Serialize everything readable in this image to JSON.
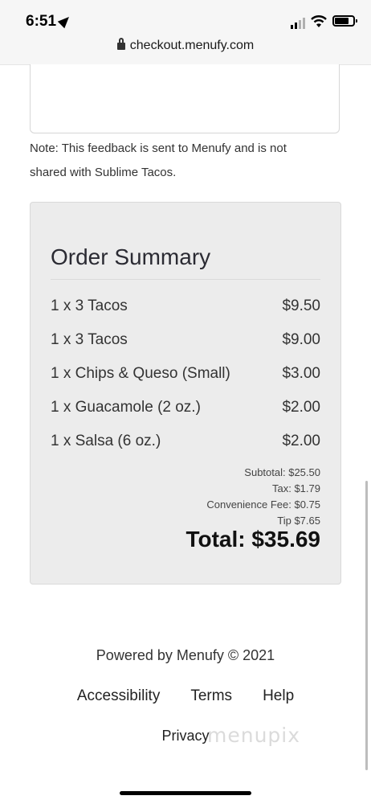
{
  "status_bar": {
    "time": "6:51",
    "url": "checkout.menufy.com"
  },
  "feedback": {
    "note_line1": "Note: This feedback is sent to Menufy and is not",
    "note_line2": "shared with Sublime Tacos."
  },
  "order_summary": {
    "title": "Order Summary",
    "items": [
      {
        "label": "1 x 3 Tacos",
        "price": "$9.50"
      },
      {
        "label": "1 x 3 Tacos",
        "price": "$9.00"
      },
      {
        "label": "1 x Chips & Queso (Small)",
        "price": "$3.00"
      },
      {
        "label": "1 x Guacamole (2 oz.)",
        "price": "$2.00"
      },
      {
        "label": "1 x Salsa (6 oz.)",
        "price": "$2.00"
      }
    ],
    "subtotal": "Subtotal: $25.50",
    "tax": "Tax: $1.79",
    "convenience_fee": "Convenience Fee: $0.75",
    "tip": "Tip $7.65",
    "total": "Total: $35.69"
  },
  "footer": {
    "powered_by": "Powered by Menufy © 2021",
    "links": {
      "accessibility": "Accessibility",
      "terms": "Terms",
      "help": "Help",
      "privacy": "Privacy"
    }
  },
  "watermark": "menupix",
  "icons": {
    "location": "location-arrow-icon",
    "signal": "cellular-signal-icon",
    "wifi": "wifi-icon",
    "battery": "battery-icon",
    "lock": "lock-icon"
  }
}
